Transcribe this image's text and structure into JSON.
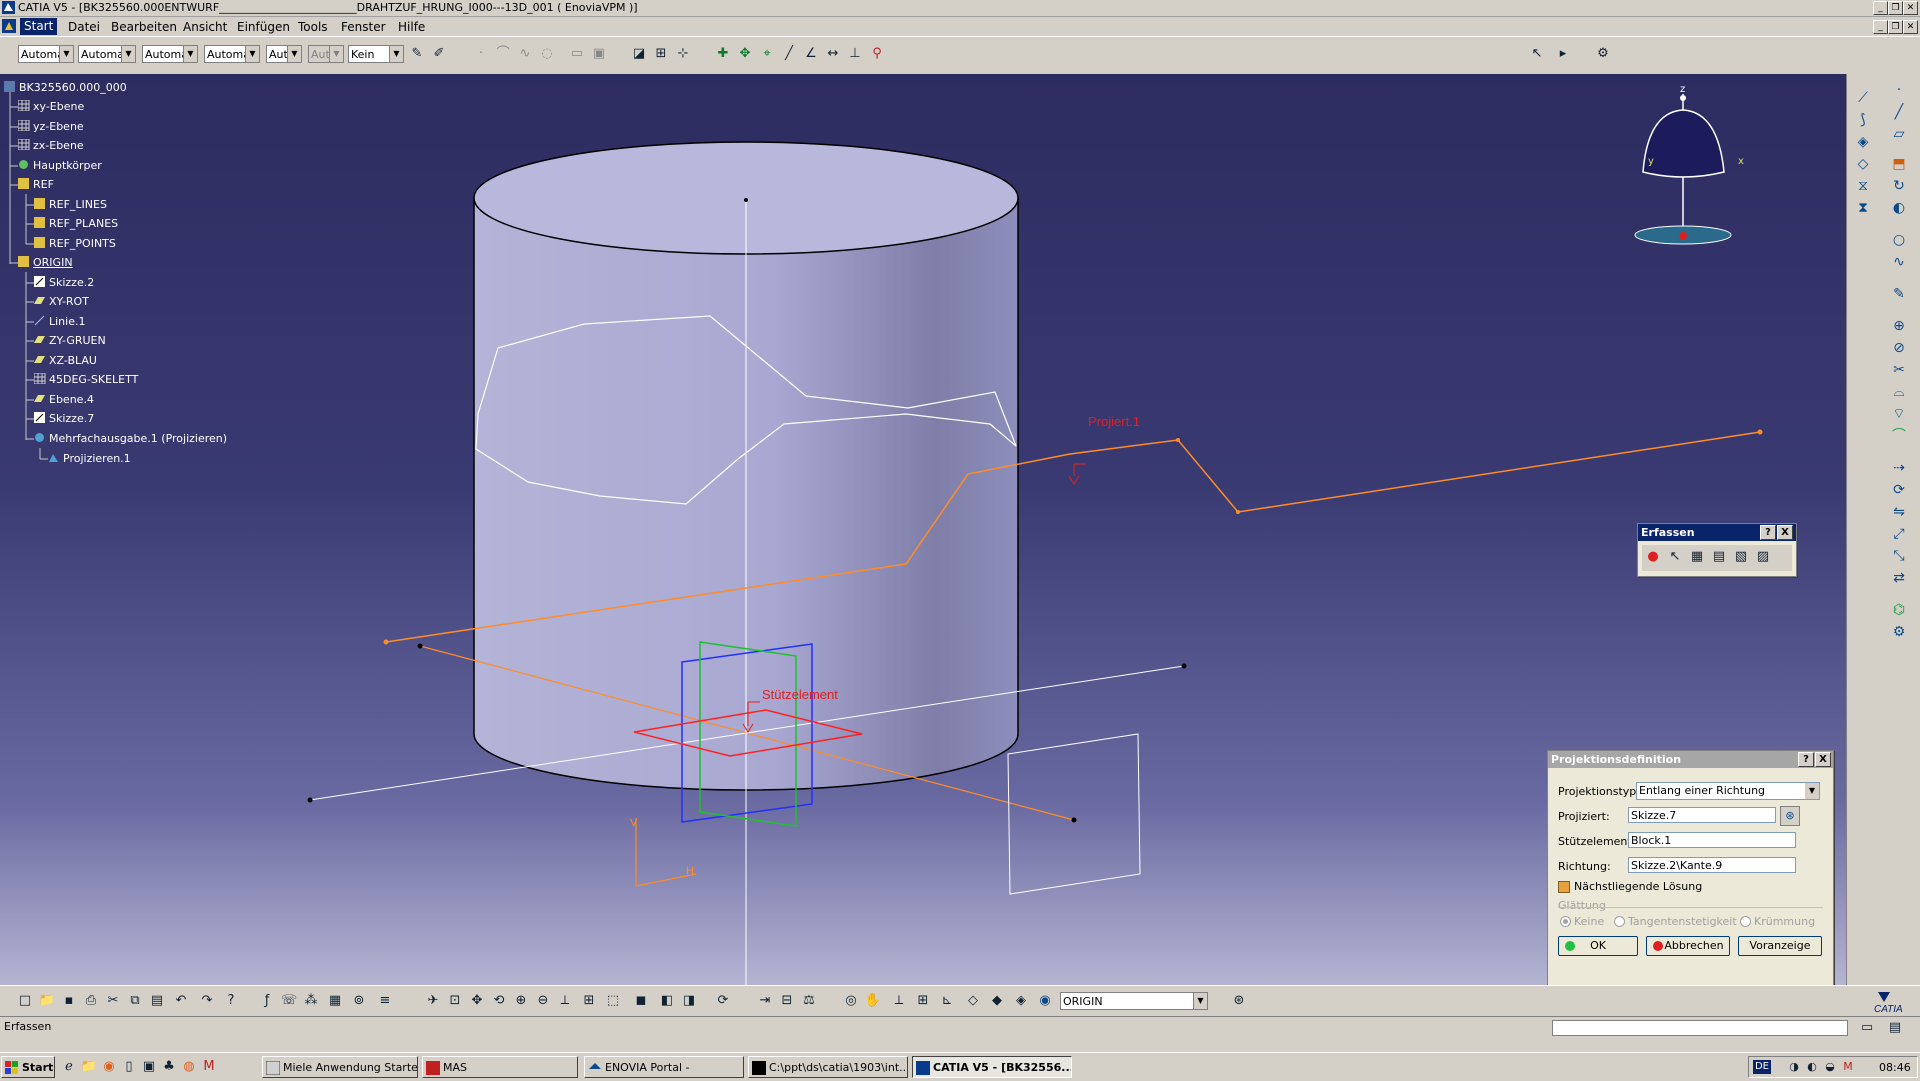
{
  "window": {
    "title": "CATIA V5 - [BK325560.000ENTWURF_________________________DRAHTZUF_HRUNG_I000---13D_001 ( EnoviaVPM )]"
  },
  "menu": [
    "Start",
    "Datei",
    "Bearbeiten",
    "Ansicht",
    "Einfügen",
    "Tools",
    "Fenster",
    "Hilfe"
  ],
  "toolbar_top": {
    "combos": [
      "Automa",
      "Automa",
      "Automa",
      "Automa",
      "Aut",
      "Aut",
      "Kein"
    ]
  },
  "tree": [
    {
      "label": "BK325560.000_000",
      "selected": false
    },
    {
      "label": "xy-Ebene",
      "selected": false
    },
    {
      "label": "yz-Ebene",
      "selected": false
    },
    {
      "label": "zx-Ebene",
      "selected": false
    },
    {
      "label": "Hauptkörper",
      "selected": false
    },
    {
      "label": "REF",
      "selected": false
    },
    {
      "label": "REF_LINES",
      "selected": false
    },
    {
      "label": "REF_PLANES",
      "selected": false
    },
    {
      "label": "REF_POINTS",
      "selected": false
    },
    {
      "label": "ORIGIN",
      "selected": false
    },
    {
      "label": "Skizze.2",
      "selected": true
    },
    {
      "label": "XY-ROT",
      "selected": false
    },
    {
      "label": "Linie.1",
      "selected": false
    },
    {
      "label": "ZY-GRUEN",
      "selected": false
    },
    {
      "label": "XZ-BLAU",
      "selected": false
    },
    {
      "label": "45DEG-SKELETT",
      "selected": false
    },
    {
      "label": "Ebene.4",
      "selected": false
    },
    {
      "label": "Skizze.7",
      "selected": true
    },
    {
      "label": "Mehrfachausgabe.1 (Projizieren)",
      "selected": false
    },
    {
      "label": "Projizieren.1",
      "selected": false
    }
  ],
  "viewport_labels": {
    "projected": "Projiert.1",
    "support": "Stützelement",
    "axis_v": "V",
    "axis_h": "H"
  },
  "compass": {
    "z": "z",
    "y": "y",
    "x": "x"
  },
  "erfassen": {
    "title": "Erfassen",
    "help": "?",
    "close": "X"
  },
  "proj_dialog": {
    "title": "Projektionsdefinition",
    "help": "?",
    "close": "X",
    "type_label": "Projektionstyp:",
    "type_value": "Entlang einer Richtung",
    "projected_label": "Projiziert:",
    "projected_value": "Skizze.7",
    "support_label": "Stützelement:",
    "support_value": "Block.1",
    "direction_label": "Richtung:",
    "direction_value": "Skizze.2\\Kante.9",
    "nearest_label": "Nächstliegende Lösung",
    "nearest_checked": true,
    "smoothing_label": "Glättung",
    "smooth_none": "Keine",
    "smooth_tangent": "Tangentenstetigkeit",
    "smooth_curvature": "Krümmung",
    "smooth_selected": "Keine",
    "ok": "OK",
    "cancel": "Abbrechen",
    "preview": "Voranzeige"
  },
  "bottom_toolbar": {
    "origin_combo": "ORIGIN"
  },
  "status": {
    "text": "Erfassen"
  },
  "logo": "CATIA",
  "taskbar": {
    "start": "Start",
    "tasks": [
      {
        "label": "Miele Anwendung Starter",
        "active": false
      },
      {
        "label": "MAS",
        "active": false
      },
      {
        "label": "ENOVIA Portal -",
        "active": false
      },
      {
        "label": "C:\\ppt\\ds\\catia\\1903\\int...",
        "active": false
      },
      {
        "label": "CATIA V5 - [BK32556...",
        "active": true
      }
    ],
    "lang": "DE",
    "clock": "08:46"
  },
  "colors": {
    "accent_selected": "#ff8a00",
    "projection_line": "#ff8c28",
    "label_red": "#e02020"
  }
}
